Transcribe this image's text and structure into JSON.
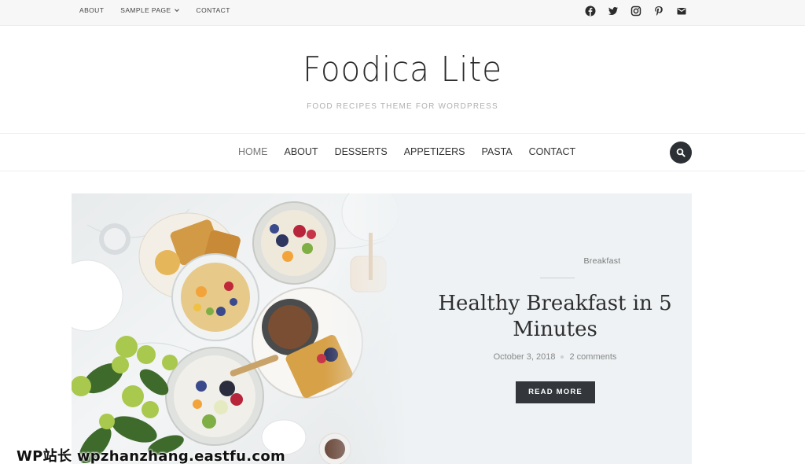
{
  "topbar": {
    "links": [
      "ABOUT",
      "SAMPLE PAGE",
      "CONTACT"
    ],
    "social_icons": [
      "facebook-icon",
      "twitter-icon",
      "instagram-icon",
      "pinterest-icon",
      "mail-icon"
    ]
  },
  "header": {
    "site_title": "Foodica Lite",
    "tagline": "FOOD RECIPES THEME FOR WORDPRESS"
  },
  "main_nav": {
    "items": [
      "HOME",
      "ABOUT",
      "DESSERTS",
      "APPETIZERS",
      "PASTA",
      "CONTACT"
    ],
    "active": "HOME",
    "search_icon": "search-icon"
  },
  "featured_post": {
    "category": "Breakfast",
    "title": "Healthy Breakfast in 5 Minutes",
    "date": "October 3, 2018",
    "comments": "2 comments",
    "button": "READ MORE"
  },
  "watermark": "WP站长 wpzhanzhang.eastfu.com",
  "colors": {
    "topbar_bg": "#f7f7f7",
    "hero_bg": "#eef2f4",
    "button_bg": "#33373c",
    "search_bg": "#2c2f33",
    "tagline": "#b0b0b0"
  }
}
